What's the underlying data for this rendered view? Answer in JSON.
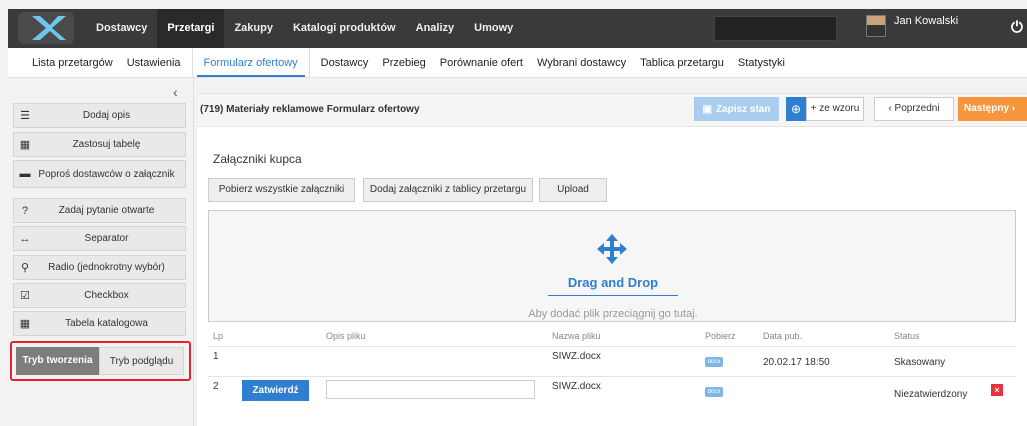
{
  "topbar": {
    "nav": [
      "Dostawcy",
      "Przetargi",
      "Zakupy",
      "Katalogi produktów",
      "Analizy",
      "Umowy"
    ],
    "active_index": 1,
    "user_name": "Jan Kowalski",
    "power_icon": "⏻"
  },
  "subnav": {
    "items": [
      "Lista przetargów",
      "Ustawienia",
      "Formularz ofertowy",
      "Dostawcy",
      "Przebieg",
      "Porównanie ofert",
      "Wybrani dostawcy",
      "Tablica przetargu",
      "Statystyki"
    ],
    "active": "Formularz ofertowy"
  },
  "sidebar": {
    "collapse_icon": "‹",
    "buttons": [
      {
        "label": "Dodaj opis",
        "icon": "☰"
      },
      {
        "label": "Zastosuj tabelę",
        "icon": "▦"
      },
      {
        "label": "Poproś dostawców o załącznik",
        "icon": "▬"
      },
      {
        "label": "Zadaj pytanie otwarte",
        "icon": "?"
      },
      {
        "label": "Separator",
        "icon": "↔"
      },
      {
        "label": "Radio (jednokrotny wybór)",
        "icon": "⚲"
      },
      {
        "label": "Checkbox",
        "icon": "☑"
      },
      {
        "label": "Tabela katalogowa",
        "icon": "▦"
      }
    ],
    "mode": {
      "create": "Tryb tworzenia",
      "preview": "Tryb podglądu",
      "highlight_color": "#e8232f"
    }
  },
  "toolbar": {
    "form_title": "(719) Materiały reklamowe Formularz ofertowy",
    "save": "Zapisz stan",
    "template_icon": "⊕",
    "from_template": "+ ze wzoru",
    "prev": "‹  Poprzedni",
    "next": "Następny  ›"
  },
  "attachments": {
    "title": "Załączniki kupca",
    "buttons": [
      "Pobierz wszystkie załączniki",
      "Dodaj załączniki z tablicy przetargu",
      "Upload"
    ],
    "dropzone_title": "Drag and Drop",
    "dropzone_hint": "Aby dodać plik przeciągnij go tutaj.",
    "columns": [
      "Lp",
      "Opis pliku",
      "Nazwa pliku",
      "Pobierz",
      "Data pub.",
      "Status"
    ],
    "rows": [
      {
        "lp": "1",
        "file": "SIWZ.docx",
        "icon": "docx",
        "date": "20.02.17 18:50",
        "status": "Skasowany"
      },
      {
        "lp": "2",
        "confirm": "Zatwierdź",
        "file": "SIWZ.docx",
        "icon": "docx",
        "date": "",
        "status": "Niezatwierdzony",
        "delete_icon": "×"
      }
    ]
  },
  "colors": {
    "accent": "#2e7fcf",
    "next": "#f6953c",
    "topbar": "#3a3a3a"
  }
}
